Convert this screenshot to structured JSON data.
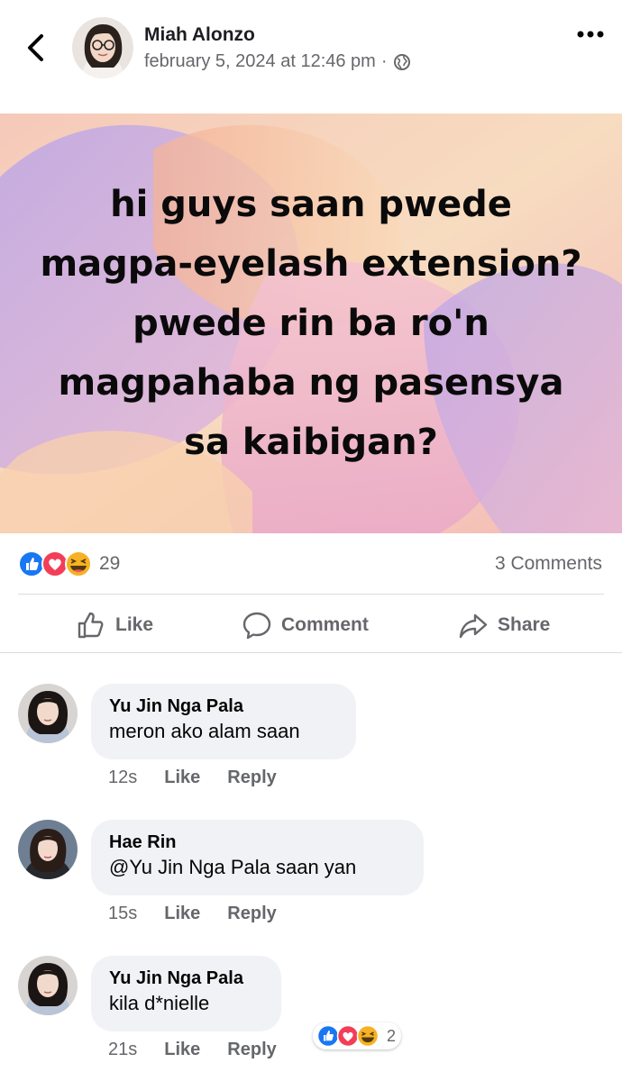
{
  "header": {
    "author": "Miah Alonzo",
    "timestamp": "february 5, 2024 at 12:46 pm",
    "separator": "·",
    "privacy_icon": "globe-icon",
    "back_icon": "chevron-left-icon",
    "more_icon": "more-horizontal-icon"
  },
  "post": {
    "text": "hi guys saan pwede magpa-eyelash extension? pwede rin ba ro'n magpahaba ng pasensya sa kaibigan?"
  },
  "reactions": {
    "types": [
      "like",
      "love",
      "haha"
    ],
    "count": "29",
    "comments_label": "3 Comments"
  },
  "actions": {
    "like": "Like",
    "comment": "Comment",
    "share": "Share"
  },
  "comments": [
    {
      "name": "Yu Jin Nga Pala",
      "text": "meron ako alam saan",
      "time": "12s",
      "like": "Like",
      "reply": "Reply"
    },
    {
      "name": "Hae Rin",
      "text": "@Yu Jin Nga Pala saan yan",
      "time": "15s",
      "like": "Like",
      "reply": "Reply"
    },
    {
      "name": "Yu Jin Nga Pala",
      "text": "kila d*nielle",
      "time": "21s",
      "like": "Like",
      "reply": "Reply",
      "reaction_count": "2"
    }
  ],
  "colors": {
    "like_blue": "#1877f2",
    "love_red": "#f33e58",
    "haha_yellow": "#f7b125",
    "muted": "#65676b",
    "bubble": "#f0f2f5"
  }
}
